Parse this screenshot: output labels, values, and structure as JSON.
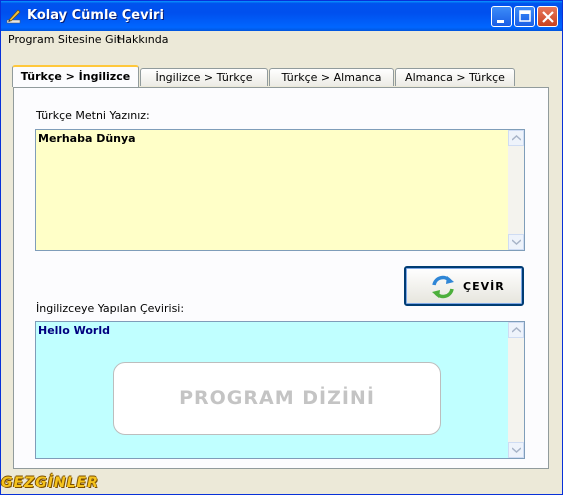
{
  "window": {
    "title": "Kolay Cümle Çeviri",
    "icon": "pencil-icon"
  },
  "menu": {
    "items": [
      "Program Sitesine Git",
      "Hakkında"
    ]
  },
  "tabs": [
    "Türkçe > İngilizce",
    "İngilizce > Türkçe",
    "Türkçe > Almanca",
    "Almanca > Türkçe"
  ],
  "active_tab": 0,
  "input": {
    "label": "Türkçe Metni Yazınız:",
    "value": "Merhaba Dünya",
    "bg": "#ffffc8"
  },
  "translate_button": {
    "label": "ÇEVİR",
    "icon": "refresh-arrows-icon"
  },
  "output": {
    "label": "İngilizceye Yapılan Çevirisi:",
    "value": "Hello World",
    "bg": "#c0ffff",
    "text_color": "#00007f"
  },
  "watermark": "PROGRAM DİZİNİ",
  "logo": "GEZGİNLER"
}
